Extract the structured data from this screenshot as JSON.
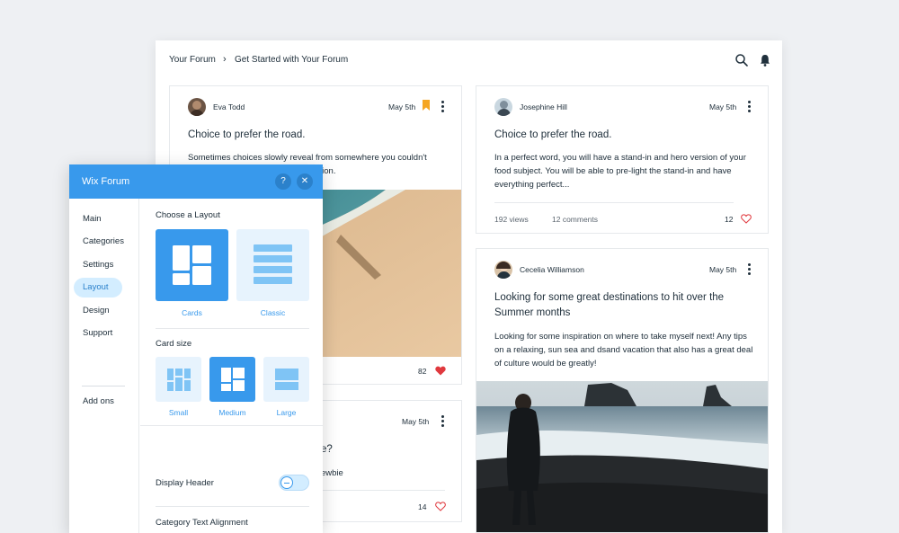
{
  "forum": {
    "breadcrumb": [
      "Your Forum",
      "Get Started with Your Forum"
    ],
    "top_icons": [
      "search-icon",
      "bell-icon"
    ],
    "posts": [
      {
        "author": "Eva Todd",
        "date": "May 5th",
        "title": "Choice to prefer the road.",
        "body": "Sometimes choices slowly reveal from somewhere you couldn't expect, that I've made an odd decision.",
        "likes": "82",
        "liked": true
      },
      {
        "author": "Josephine Hill",
        "date": "May 5th",
        "title": "Choice to prefer the road.",
        "body": "In a perfect word, you will have a stand-in and hero version of your food subject. You will be able to pre-light the stand-in and have everything perfect...",
        "views": "192 views",
        "comments": "12 comments",
        "likes": "12",
        "liked": false
      },
      {
        "author": "Cecelia Williamson",
        "date": "May 5th",
        "title": "Looking for some great destinations to hit over the Summer months",
        "body": "Looking for some inspiration on where to take myself next! Any tips on a relaxing, sun sea and dsand vacation that also has a great deal of culture would be greatly!"
      },
      {
        "date": "May 5th",
        "title_fragment": "e?",
        "body_fragment": "ewbie",
        "likes": "14",
        "liked": false
      }
    ]
  },
  "panel": {
    "title": "Wix Forum",
    "help_glyph": "?",
    "close_glyph": "✕",
    "nav": [
      {
        "label": "Main",
        "active": false
      },
      {
        "label": "Categories",
        "active": false
      },
      {
        "label": "Settings",
        "active": false
      },
      {
        "label": "Layout",
        "active": true
      },
      {
        "label": "Design",
        "active": false
      },
      {
        "label": "Support",
        "active": false
      }
    ],
    "addons": "Add ons",
    "layout": {
      "title": "Choose a Layout",
      "options": [
        {
          "label": "Cards",
          "selected": true
        },
        {
          "label": "Classic",
          "selected": false
        }
      ]
    },
    "card_size": {
      "title": "Card size",
      "options": [
        {
          "label": "Small",
          "selected": false
        },
        {
          "label": "Medium",
          "selected": true
        },
        {
          "label": "Large",
          "selected": false
        }
      ]
    },
    "display_header": {
      "label": "Display Header",
      "on": false
    },
    "alignment": {
      "title": "Category Text Alignment",
      "options": [
        {
          "icon": "align-left-icon",
          "selected": true
        },
        {
          "icon": "align-center-icon",
          "selected": false
        }
      ]
    }
  },
  "colors": {
    "accent": "#3899ec",
    "accent_light": "#d3edff",
    "bookmark": "#f5a623",
    "heart": "#e0393e"
  }
}
